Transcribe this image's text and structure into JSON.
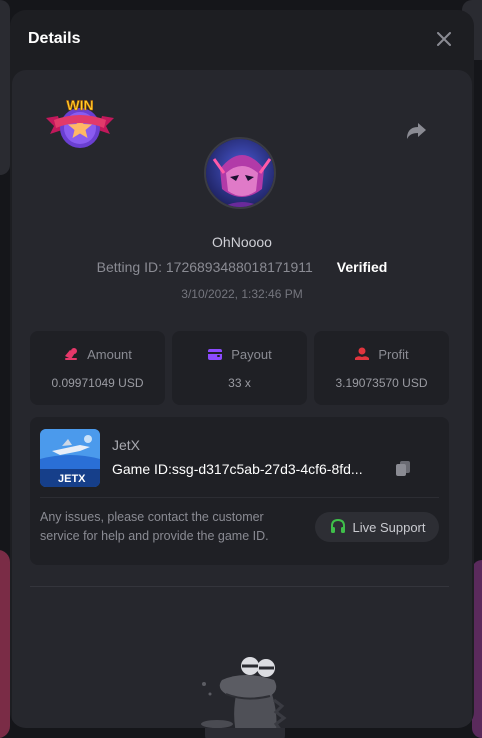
{
  "modal": {
    "title": "Details"
  },
  "badge": {
    "text": "WIN"
  },
  "player": {
    "username": "OhNoooo",
    "betting_id": "Betting ID: 1726893488018171911",
    "status": "Verified",
    "date": "3/10/2022, 1:32:46 PM"
  },
  "stats": {
    "amount": {
      "label": "Amount",
      "value": "0.09971049 USD",
      "color": "#e5386a"
    },
    "payout": {
      "label": "Payout",
      "value": "33 x",
      "color": "#8c4bff"
    },
    "profit": {
      "label": "Profit",
      "value": "3.19073570 USD",
      "color": "#e0353e"
    }
  },
  "game": {
    "name": "JetX",
    "game_id": "Game ID:ssg-d317c5ab-27d3-4cf6-8fd...",
    "thumb_label": "JETX"
  },
  "support": {
    "text": "Any issues, please contact the customer service for help and provide the game ID.",
    "button_label": "Live Support",
    "icon_color": "#3fbf4a"
  }
}
